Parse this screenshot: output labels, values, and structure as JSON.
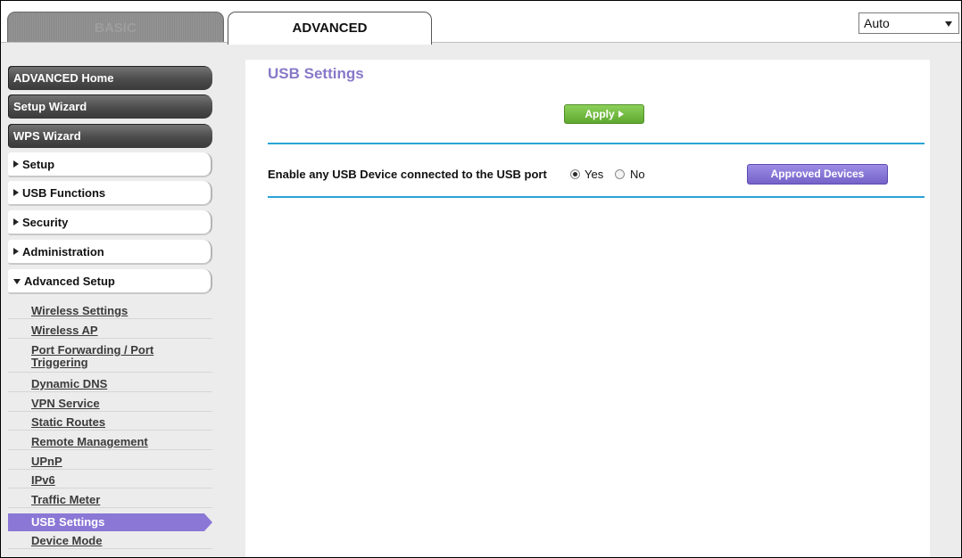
{
  "tabs": {
    "basic": "BASIC",
    "advanced": "ADVANCED"
  },
  "language_select": {
    "value": "Auto"
  },
  "sidebar": {
    "main_buttons": [
      "ADVANCED Home",
      "Setup Wizard",
      "WPS Wizard"
    ],
    "sections": [
      "Setup",
      "USB Functions",
      "Security",
      "Administration",
      "Advanced Setup"
    ],
    "advanced_setup_links": [
      "Wireless Settings",
      "Wireless AP",
      "Port Forwarding / Port",
      "Triggering",
      "Dynamic DNS",
      "VPN Service",
      "Static Routes",
      "Remote Management",
      "UPnP",
      "IPv6",
      "Traffic Meter",
      "USB Settings",
      "Device Mode"
    ],
    "active_link": "USB Settings"
  },
  "main": {
    "title": "USB Settings",
    "apply_label": "Apply",
    "usb_setting_label": "Enable any USB Device connected to the USB port",
    "radio_yes": "Yes",
    "radio_no": "No",
    "selected": "Yes",
    "approved_devices_label": "Approved Devices"
  },
  "colors": {
    "accent_purple": "#8878c8",
    "active_item": "#8a77d6",
    "rule_blue": "#29a3d6",
    "apply_green": "#6cb83a"
  }
}
